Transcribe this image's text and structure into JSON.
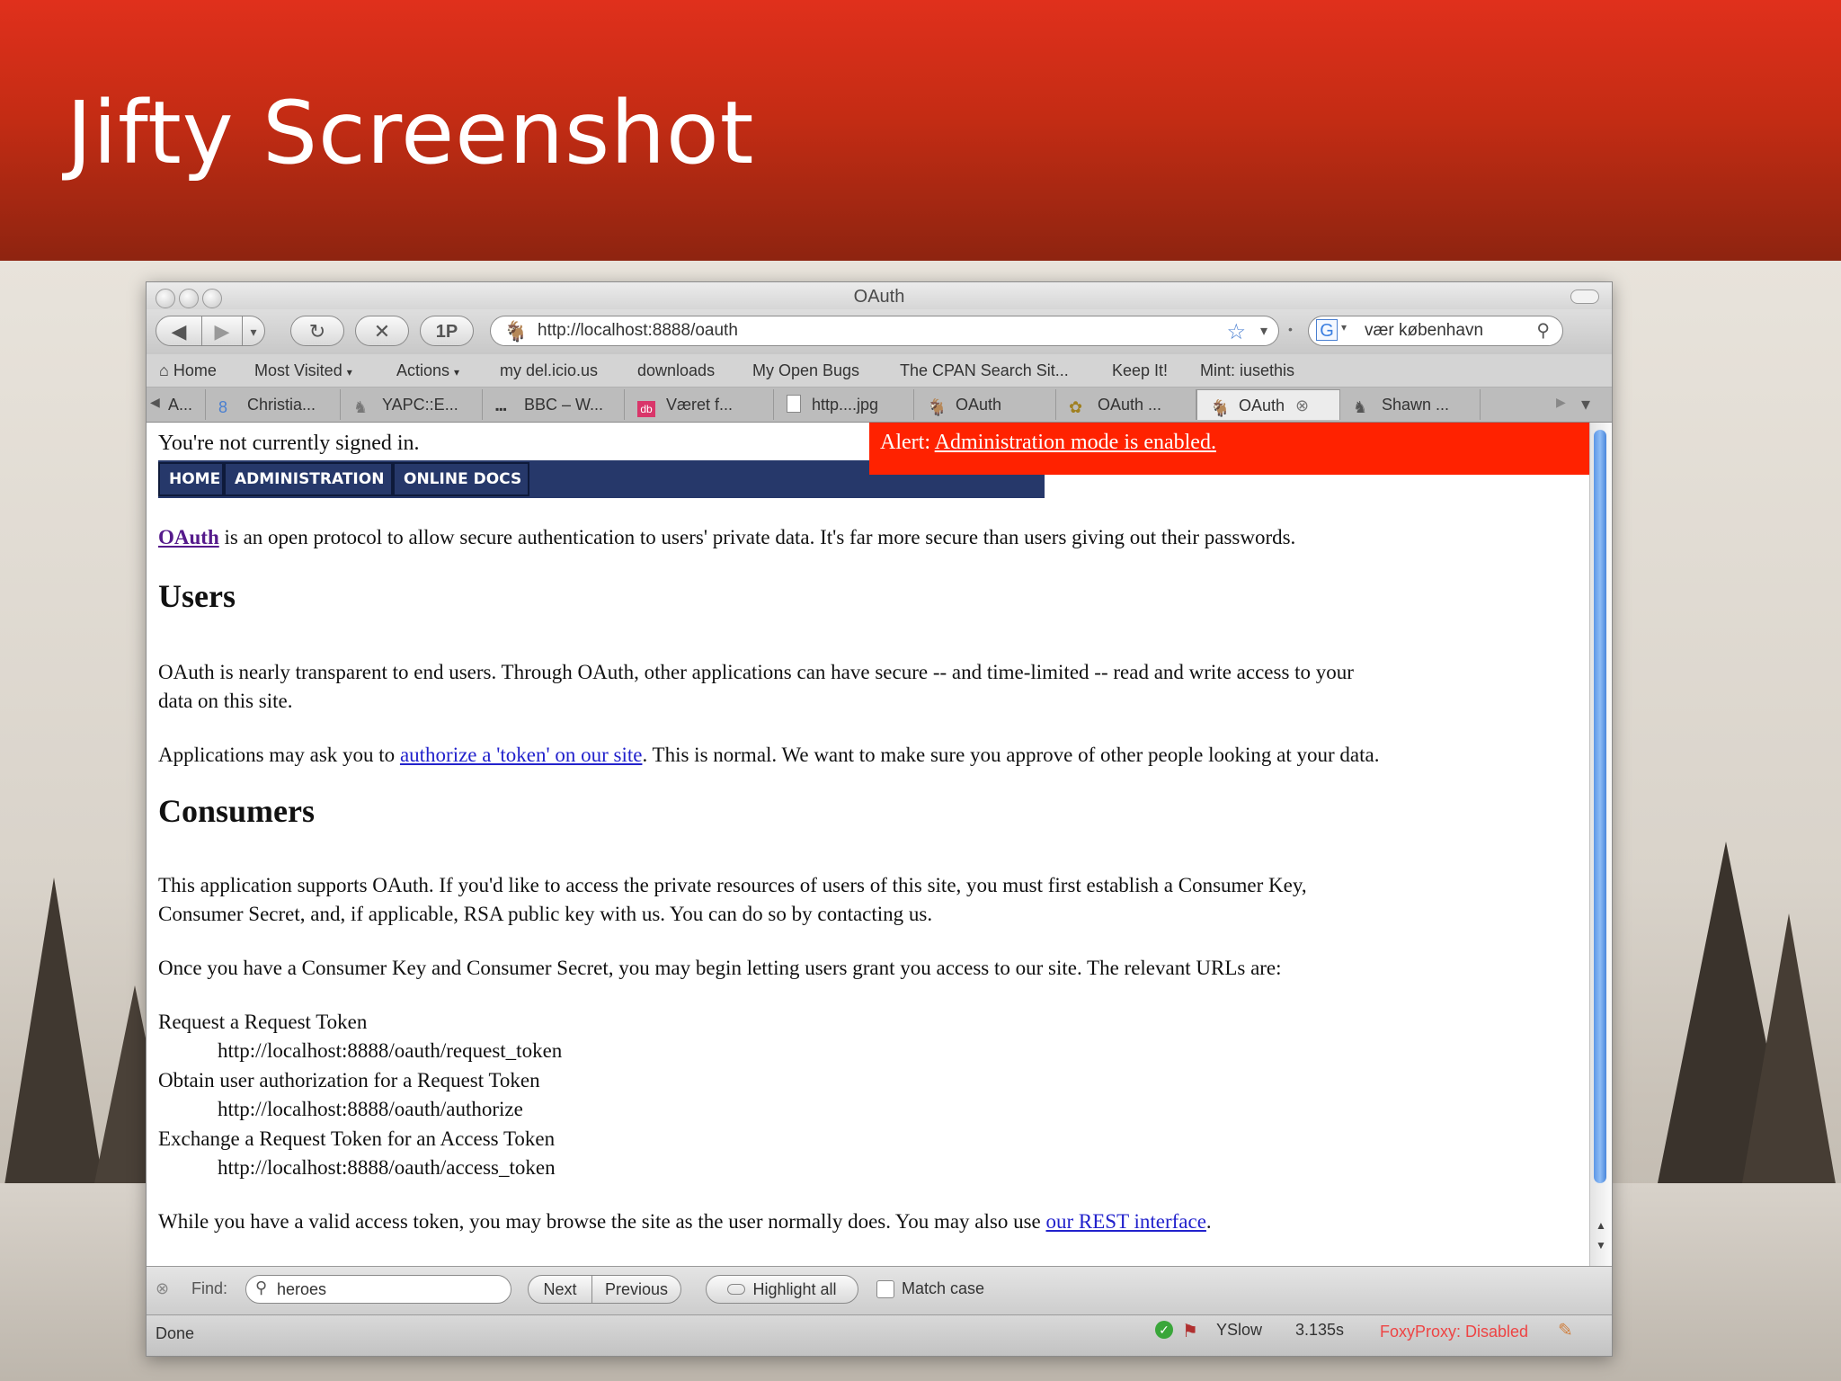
{
  "slide": {
    "title": "Jifty Screenshot"
  },
  "window": {
    "title": "OAuth"
  },
  "navbar": {
    "onepassword_label": "1P",
    "url": "http://localhost:8888/oauth",
    "search_value": "vær københavn"
  },
  "bookmarks": [
    "Home",
    "Most Visited",
    "Actions",
    "my del.icio.us",
    "downloads",
    "My Open Bugs",
    "The CPAN Search Sit...",
    "Keep It!",
    "Mint: iusethis"
  ],
  "tabs": [
    {
      "label": "A..."
    },
    {
      "label": "Christia..."
    },
    {
      "label": "YAPC::E..."
    },
    {
      "label": "BBC – W..."
    },
    {
      "label": "Været f..."
    },
    {
      "label": "http....jpg"
    },
    {
      "label": "OAuth"
    },
    {
      "label": "OAuth ..."
    },
    {
      "label": "OAuth"
    },
    {
      "label": "Shawn ..."
    }
  ],
  "page": {
    "signin_text": "You're not currently signed in.",
    "menu": [
      "HOME",
      "ADMINISTRATION",
      "ONLINE DOCS"
    ],
    "alert_prefix": "Alert:",
    "alert_link": "Administration mode is enabled.",
    "intro_link": "OAuth",
    "intro_rest": " is an open protocol to allow secure authentication to users' private data. It's far more secure than users giving out their passwords.",
    "users_heading": "Users",
    "users_p1_line1": "OAuth is nearly transparent to end users. Through OAuth, other applications can have secure -- and time-limited -- read and write access to your",
    "users_p1_line2": "data on this site.",
    "users_p2_pre": "Applications may ask you to ",
    "users_p2_link": "authorize a 'token' on our site",
    "users_p2_post": ". This is normal. We want to make sure you approve of other people looking at your data.",
    "consumers_heading": "Consumers",
    "cons_p1_line1": "This application supports OAuth. If you'd like to access the private resources of users of this site, you must first establish a Consumer Key,",
    "cons_p1_line2": "Consumer Secret, and, if applicable, RSA public key with us. You can do so by contacting us.",
    "cons_p2": "Once you have a Consumer Key and Consumer Secret, you may begin letting users grant you access to our site. The relevant URLs are:",
    "urls": [
      {
        "label": "Request a Request Token",
        "url": "http://localhost:8888/oauth/request_token"
      },
      {
        "label": "Obtain user authorization for a Request Token",
        "url": "http://localhost:8888/oauth/authorize"
      },
      {
        "label": "Exchange a Request Token for an Access Token",
        "url": "http://localhost:8888/oauth/access_token"
      }
    ],
    "final_pre": "While you have a valid access token, you may browse the site as the user normally does. You may also use ",
    "final_link": "our REST interface",
    "final_post": "."
  },
  "findbar": {
    "label": "Find:",
    "value": "heroes",
    "next": "Next",
    "previous": "Previous",
    "highlight": "Highlight all",
    "match_case": "Match case"
  },
  "statusbar": {
    "status": "Done",
    "yslow": "YSlow",
    "time": "3.135s",
    "foxyproxy": "FoxyProxy: Disabled"
  },
  "colors": {
    "banner": "#c42c14",
    "alert": "#ff2200",
    "menu": "#26386a",
    "link": "#2222cc"
  }
}
